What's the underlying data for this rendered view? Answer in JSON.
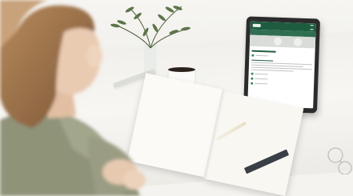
{
  "scene": {
    "description_free": true
  },
  "tablet": {
    "header_color": "#1d5c3f",
    "accent_color": "#2f8a5a"
  },
  "colors": {
    "desk": "#f4f3ef",
    "notebook": "#fbfaf6",
    "sweater": "#8f9378",
    "hair": "#a4774d"
  }
}
